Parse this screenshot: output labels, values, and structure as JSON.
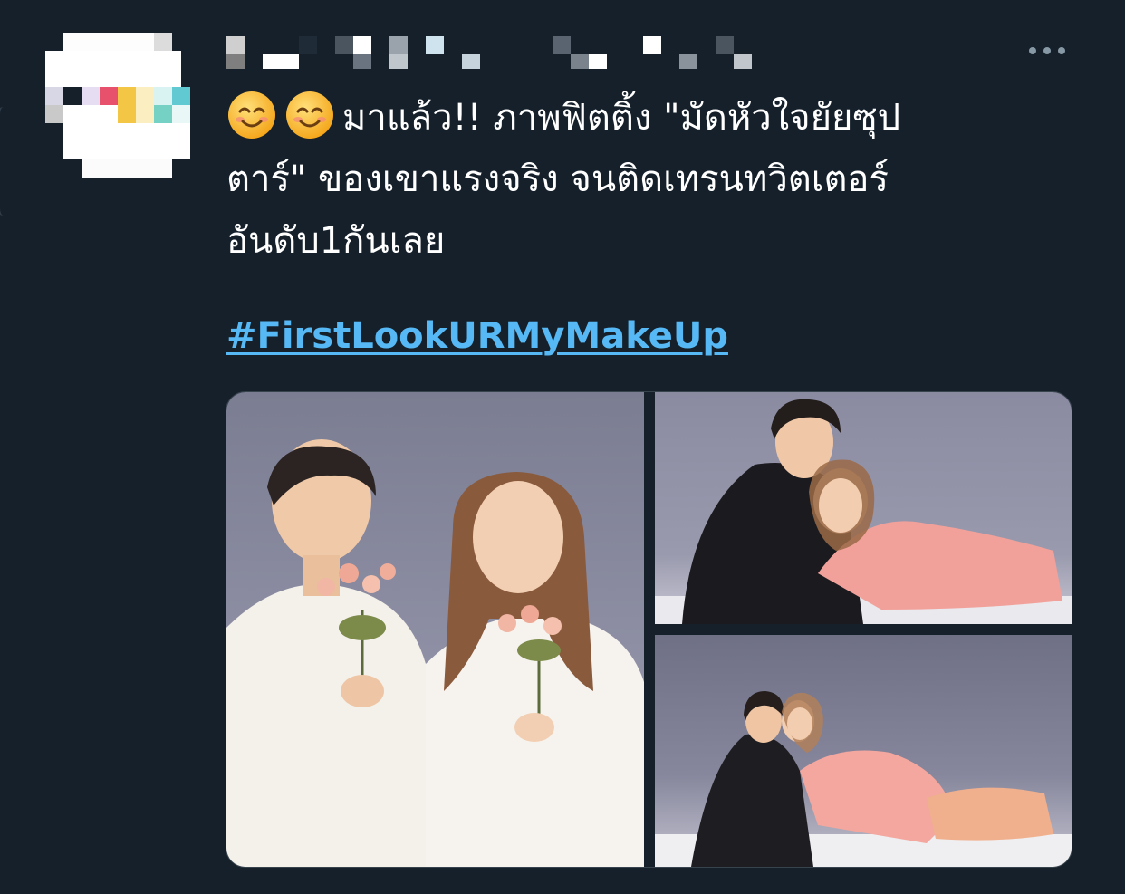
{
  "tweet": {
    "avatar_icon": "censored-avatar",
    "more_icon": "more-horizontal-icon",
    "emojis": [
      "smiling-face-icon",
      "smiling-face-icon"
    ],
    "text_lines": [
      "มาแล้ว!! ภาพฟิตติ้ง \"มัดหัวใจยัยซุป",
      "ตาร์\" ของเขาแรงจริง จนติดเทรนทวิตเตอร์",
      "อันดับ1กันเลย"
    ],
    "hashtag": "#FirstLookURMyMakeUp",
    "media": [
      {
        "name": "photo-couple-with-flowers"
      },
      {
        "name": "photo-couple-sitting-kiss-forehead"
      },
      {
        "name": "photo-couple-playful-pose"
      }
    ]
  },
  "colors": {
    "background": "#15202b",
    "text": "#ffffff",
    "link": "#56b8f4",
    "icon": "#8899a6"
  }
}
